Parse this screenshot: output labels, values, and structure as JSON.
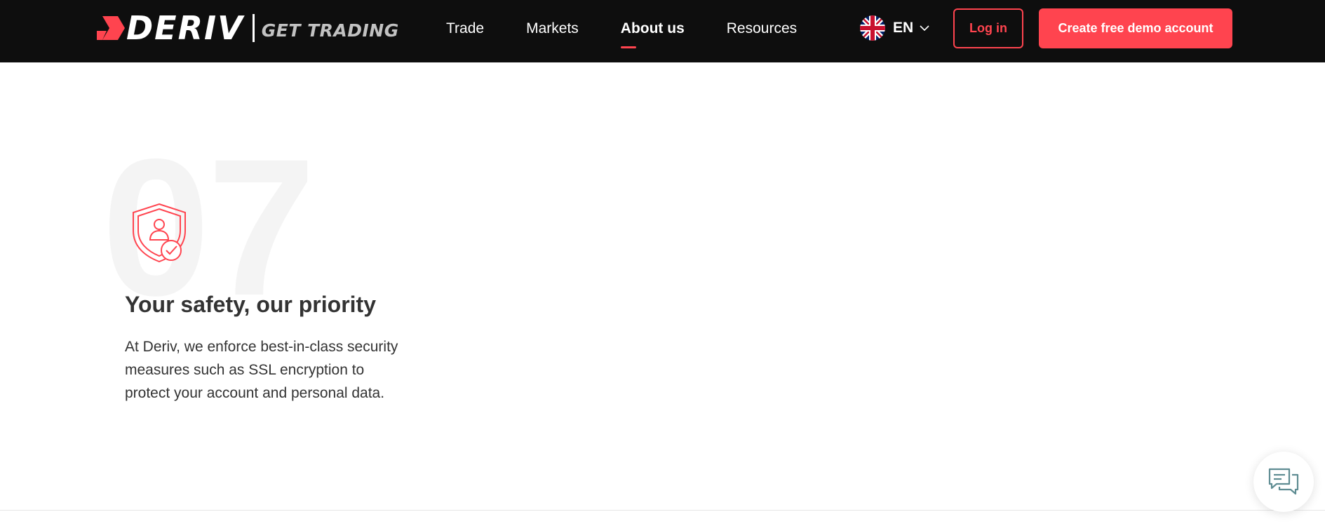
{
  "header": {
    "logo": {
      "brand": "DERIV",
      "tagline": "GET TRADING",
      "icon": "deriv-logo-icon"
    },
    "nav": {
      "items": [
        {
          "label": "Trade",
          "active": false
        },
        {
          "label": "Markets",
          "active": false
        },
        {
          "label": "About us",
          "active": true
        },
        {
          "label": "Resources",
          "active": false
        }
      ]
    },
    "language": {
      "code": "EN",
      "flag_icon": "uk-flag-icon",
      "dropdown_icon": "chevron-down-icon"
    },
    "login_label": "Log in",
    "demo_label": "Create free demo account"
  },
  "feature": {
    "number": "07",
    "icon": "shield-user-check-icon",
    "title": "Your safety, our priority",
    "description": "At Deriv, we enforce best-in-class security measures such as SSL encryption to protect your account and personal data."
  },
  "chat": {
    "icon": "chat-bubbles-icon"
  },
  "colors": {
    "header_bg": "#0e0e0e",
    "accent": "#ff444f",
    "text": "#333333",
    "muted_number": "#f4f4f4"
  }
}
